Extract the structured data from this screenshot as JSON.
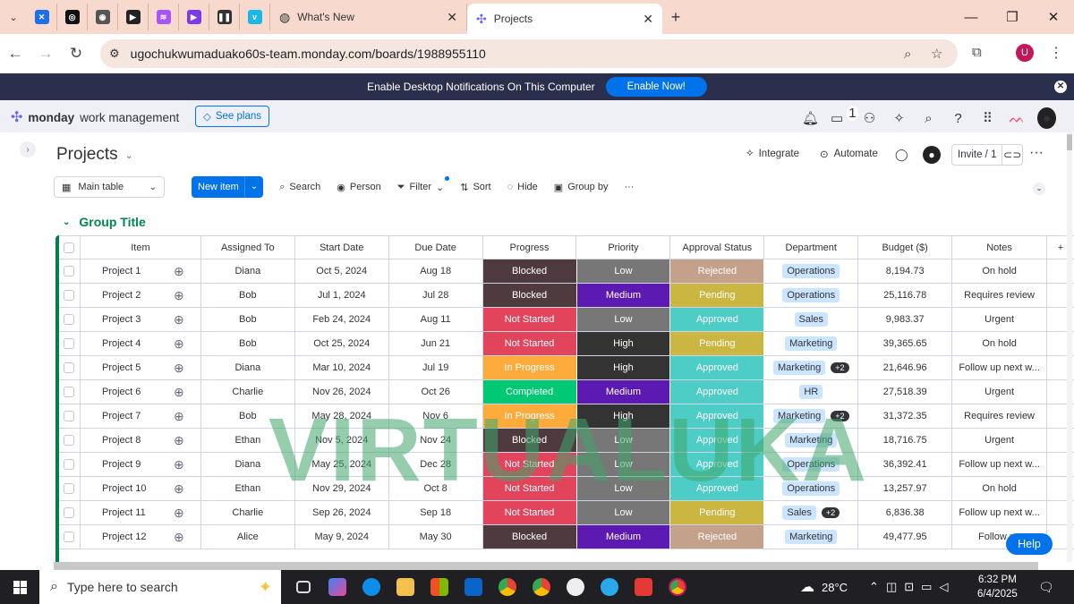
{
  "browser": {
    "tabs": [
      {
        "label": "What's New"
      },
      {
        "label": "Projects"
      }
    ],
    "url": "ugochukwumaduako60s-team.monday.com/boards/1988955110",
    "profile_initial": "U"
  },
  "notification": {
    "text": "Enable Desktop Notifications On This Computer",
    "button": "Enable Now!"
  },
  "app": {
    "brand_bold": "monday",
    "brand_rest": "work management",
    "see_plans": "See plans",
    "inbox_badge": "1"
  },
  "board": {
    "title": "Projects",
    "integrate": "Integrate",
    "automate": "Automate",
    "invite": "Invite / 1",
    "view": "Main table",
    "new_item": "New item",
    "toolbar": {
      "search": "Search",
      "person": "Person",
      "filter": "Filter",
      "sort": "Sort",
      "hide": "Hide",
      "group_by": "Group by"
    },
    "group_title": "Group Title",
    "columns": [
      "Item",
      "Assigned To",
      "Start Date",
      "Due Date",
      "Progress",
      "Priority",
      "Approval Status",
      "Department",
      "Budget ($)",
      "Notes"
    ],
    "rows": [
      {
        "item": "Project 1",
        "assigned": "Diana",
        "start": "Oct 5, 2024",
        "due": "Aug 18",
        "progress": "Blocked",
        "priority": "Low",
        "approval": "Rejected",
        "dept": "Operations",
        "extra": "",
        "budget": "8,194.73",
        "notes": "On hold"
      },
      {
        "item": "Project 2",
        "assigned": "Bob",
        "start": "Jul 1, 2024",
        "due": "Jul 28",
        "progress": "Blocked",
        "priority": "Medium",
        "approval": "Pending",
        "dept": "Operations",
        "extra": "",
        "budget": "25,116.78",
        "notes": "Requires review"
      },
      {
        "item": "Project 3",
        "assigned": "Bob",
        "start": "Feb 24, 2024",
        "due": "Aug 11",
        "progress": "Not Started",
        "priority": "Low",
        "approval": "Approved",
        "dept": "Sales",
        "extra": "",
        "budget": "9,983.37",
        "notes": "Urgent"
      },
      {
        "item": "Project 4",
        "assigned": "Bob",
        "start": "Oct 25, 2024",
        "due": "Jun 21",
        "progress": "Not Started",
        "priority": "High",
        "approval": "Pending",
        "dept": "Marketing",
        "extra": "",
        "budget": "39,365.65",
        "notes": "On hold"
      },
      {
        "item": "Project 5",
        "assigned": "Diana",
        "start": "Mar 10, 2024",
        "due": "Jul 19",
        "progress": "In Progress",
        "priority": "High",
        "approval": "Approved",
        "dept": "Marketing",
        "extra": "+2",
        "budget": "21,646.96",
        "notes": "Follow up next w..."
      },
      {
        "item": "Project 6",
        "assigned": "Charlie",
        "start": "Nov 26, 2024",
        "due": "Oct 26",
        "progress": "Completed",
        "priority": "Medium",
        "approval": "Approved",
        "dept": "HR",
        "extra": "",
        "budget": "27,518.39",
        "notes": "Urgent"
      },
      {
        "item": "Project 7",
        "assigned": "Bob",
        "start": "May 28, 2024",
        "due": "Nov 6",
        "progress": "In Progress",
        "priority": "High",
        "approval": "Approved",
        "dept": "Marketing",
        "extra": "+2",
        "budget": "31,372.35",
        "notes": "Requires review"
      },
      {
        "item": "Project 8",
        "assigned": "Ethan",
        "start": "Nov 5, 2024",
        "due": "Nov 24",
        "progress": "Blocked",
        "priority": "Low",
        "approval": "Approved",
        "dept": "Marketing",
        "extra": "",
        "budget": "18,716.75",
        "notes": "Urgent"
      },
      {
        "item": "Project 9",
        "assigned": "Diana",
        "start": "May 25, 2024",
        "due": "Dec 28",
        "progress": "Not Started",
        "priority": "Low",
        "approval": "Approved",
        "dept": "Operations",
        "extra": "",
        "budget": "36,392.41",
        "notes": "Follow up next w..."
      },
      {
        "item": "Project 10",
        "assigned": "Ethan",
        "start": "Nov 29, 2024",
        "due": "Oct 8",
        "progress": "Not Started",
        "priority": "Low",
        "approval": "Approved",
        "dept": "Operations",
        "extra": "",
        "budget": "13,257.97",
        "notes": "On hold"
      },
      {
        "item": "Project 11",
        "assigned": "Charlie",
        "start": "Sep 26, 2024",
        "due": "Sep 18",
        "progress": "Not Started",
        "priority": "Low",
        "approval": "Pending",
        "dept": "Sales",
        "extra": "+2",
        "budget": "6,836.38",
        "notes": "Follow up next w..."
      },
      {
        "item": "Project 12",
        "assigned": "Alice",
        "start": "May 9, 2024",
        "due": "May 30",
        "progress": "Blocked",
        "priority": "Medium",
        "approval": "Rejected",
        "dept": "Marketing",
        "extra": "",
        "budget": "49,477.95",
        "notes": "Follow up"
      }
    ],
    "status_colors": {
      "Blocked": "#4f3b3f",
      "Not Started": "#e2445c",
      "In Progress": "#fdab3d",
      "Completed": "#00c875",
      "Low": "#777777",
      "Medium": "#5c1ab2",
      "High": "#333333",
      "Rejected": "#c4a18a",
      "Pending": "#cab641",
      "Approved": "#4eccc6"
    }
  },
  "watermark": "VIRTUALUKA",
  "help": "Help",
  "taskbar": {
    "search_placeholder": "Type here to search",
    "temperature": "28°C",
    "time": "6:32 PM",
    "date": "6/4/2025"
  }
}
